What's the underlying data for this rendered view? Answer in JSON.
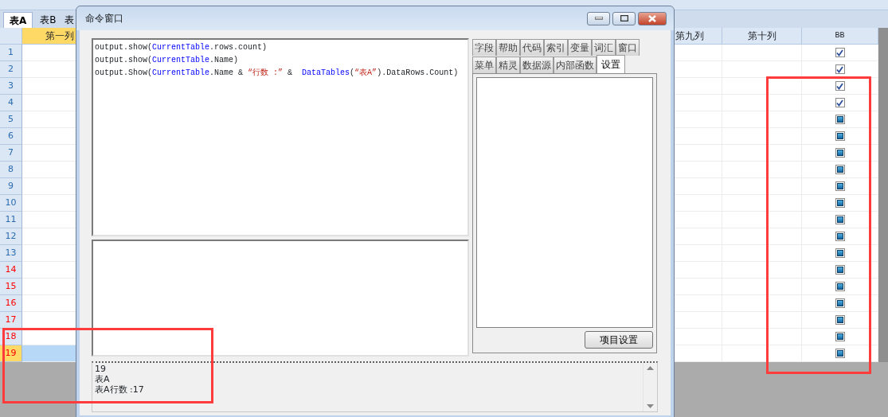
{
  "sheet_tabs": [
    {
      "label": "表A",
      "selected": true
    },
    {
      "label": "表B",
      "selected": false
    },
    {
      "label": "表",
      "selected": false
    }
  ],
  "table": {
    "columns": [
      "第一列",
      "第九列",
      "第十列",
      "BB"
    ],
    "rows": [
      {
        "number": "1",
        "color": "#2a6cb0",
        "selected": false,
        "bb_checked": true
      },
      {
        "number": "2",
        "color": "#2a6cb0",
        "selected": false,
        "bb_checked": true
      },
      {
        "number": "3",
        "color": "#2a6cb0",
        "selected": false,
        "bb_checked": true
      },
      {
        "number": "4",
        "color": "#2a6cb0",
        "selected": false,
        "bb_checked": true
      },
      {
        "number": "5",
        "color": "#2a6cb0",
        "selected": false,
        "bb_checked": null
      },
      {
        "number": "6",
        "color": "#2a6cb0",
        "selected": false,
        "bb_checked": null
      },
      {
        "number": "7",
        "color": "#2a6cb0",
        "selected": false,
        "bb_checked": null
      },
      {
        "number": "8",
        "color": "#2a6cb0",
        "selected": false,
        "bb_checked": null
      },
      {
        "number": "9",
        "color": "#2a6cb0",
        "selected": false,
        "bb_checked": null
      },
      {
        "number": "10",
        "color": "#2a6cb0",
        "selected": false,
        "bb_checked": null
      },
      {
        "number": "11",
        "color": "#2a6cb0",
        "selected": false,
        "bb_checked": null
      },
      {
        "number": "12",
        "color": "#2a6cb0",
        "selected": false,
        "bb_checked": null
      },
      {
        "number": "13",
        "color": "#2a6cb0",
        "selected": false,
        "bb_checked": null
      },
      {
        "number": "14",
        "color": "#ff0000",
        "selected": false,
        "bb_checked": null
      },
      {
        "number": "15",
        "color": "#ff0000",
        "selected": false,
        "bb_checked": null
      },
      {
        "number": "16",
        "color": "#ff0000",
        "selected": false,
        "bb_checked": null
      },
      {
        "number": "17",
        "color": "#ff0000",
        "selected": false,
        "bb_checked": null
      },
      {
        "number": "18",
        "color": "#ff0000",
        "selected": false,
        "bb_checked": null
      },
      {
        "number": "19",
        "color": "#ff0000",
        "selected": true,
        "bb_checked": null
      }
    ]
  },
  "dialog": {
    "title": "命令窗口",
    "editor_lines": [
      [
        {
          "kind": "plain",
          "text": "output.show("
        },
        {
          "kind": "keyword",
          "text": "CurrentTable"
        },
        {
          "kind": "plain",
          "text": ".rows.count)"
        }
      ],
      [
        {
          "kind": "plain",
          "text": "output.show("
        },
        {
          "kind": "keyword",
          "text": "CurrentTable"
        },
        {
          "kind": "plain",
          "text": ".Name)"
        }
      ],
      [
        {
          "kind": "plain",
          "text": "output.Show("
        },
        {
          "kind": "keyword",
          "text": "CurrentTable"
        },
        {
          "kind": "plain",
          "text": ".Name & "
        },
        {
          "kind": "string",
          "text": "“行数 :”"
        },
        {
          "kind": "plain",
          "text": " &  "
        },
        {
          "kind": "keyword",
          "text": "DataTables"
        },
        {
          "kind": "plain",
          "text": "("
        },
        {
          "kind": "string",
          "text": "“表A”"
        },
        {
          "kind": "plain",
          "text": ").DataRows.Count)"
        }
      ]
    ],
    "tab_rows": [
      [
        {
          "label": "字段",
          "selected": false
        },
        {
          "label": "帮助",
          "selected": false
        },
        {
          "label": "代码",
          "selected": false
        },
        {
          "label": "索引",
          "selected": false
        },
        {
          "label": "变量",
          "selected": false
        },
        {
          "label": "词汇",
          "selected": false
        },
        {
          "label": "窗口",
          "selected": false
        }
      ],
      [
        {
          "label": "菜单",
          "selected": false
        },
        {
          "label": "精灵",
          "selected": false
        },
        {
          "label": "数据源",
          "selected": false
        },
        {
          "label": "内部函数",
          "selected": false
        },
        {
          "label": "设置",
          "selected": true
        }
      ]
    ],
    "settings_button": "项目设置",
    "output_lines": [
      "19",
      "表A",
      "表A行数 :17"
    ]
  }
}
